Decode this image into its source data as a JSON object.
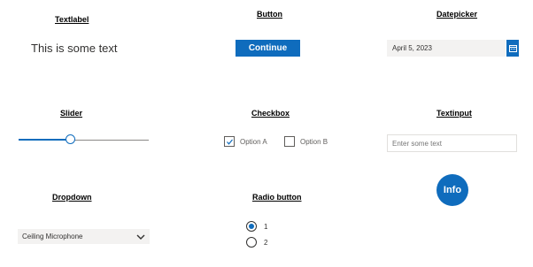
{
  "headings": {
    "textlabel": "Textlabel",
    "button": "Button",
    "datepicker": "Datepicker",
    "slider": "Slider",
    "checkbox": "Checkbox",
    "textinput": "Textinput",
    "dropdown": "Dropdown",
    "radio": "Radio button"
  },
  "textlabel": {
    "text": "This is some text"
  },
  "button": {
    "label": "Continue",
    "color": "#0f6cbd"
  },
  "datepicker": {
    "value": "April 5, 2023",
    "icon": "calendar-icon"
  },
  "slider": {
    "value_fraction": 0.39
  },
  "checkbox": {
    "options": [
      {
        "label": "Option A",
        "checked": true
      },
      {
        "label": "Option B",
        "checked": false
      }
    ]
  },
  "textinput": {
    "placeholder": "Enter some text"
  },
  "info_button": {
    "label": "Info"
  },
  "dropdown": {
    "selected": "Ceiling Microphone",
    "icon": "chevron-down-icon"
  },
  "radio": {
    "options": [
      {
        "label": "1",
        "selected": true
      },
      {
        "label": "2",
        "selected": false
      }
    ]
  }
}
